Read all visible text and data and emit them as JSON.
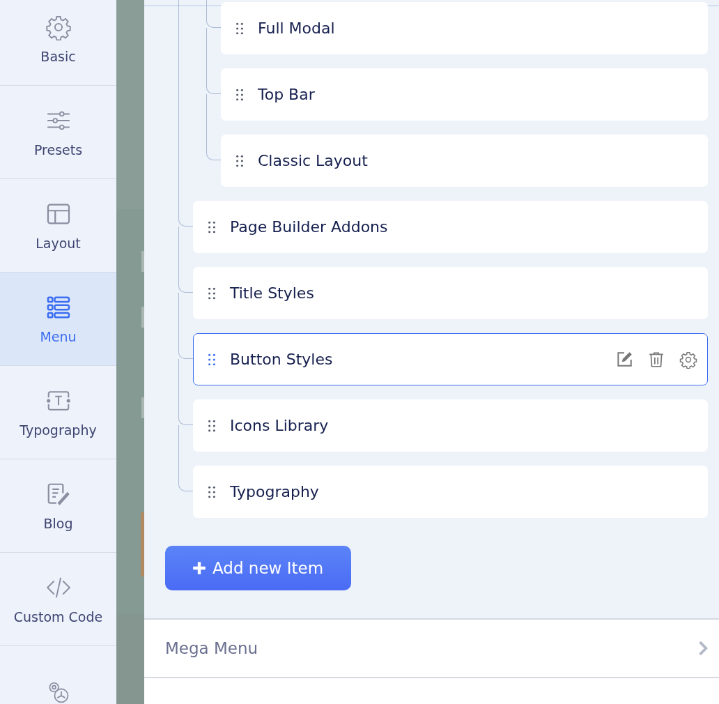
{
  "sidebar": {
    "items": [
      {
        "label": "Basic",
        "selected": false
      },
      {
        "label": "Presets",
        "selected": false
      },
      {
        "label": "Layout",
        "selected": false
      },
      {
        "label": "Menu",
        "selected": true
      },
      {
        "label": "Typography",
        "selected": false
      },
      {
        "label": "Blog",
        "selected": false
      },
      {
        "label": "Custom Code",
        "selected": false
      },
      {
        "selected": false
      }
    ]
  },
  "menu_tree": [
    {
      "children": [
        {
          "label": "Full Modal",
          "selected": false
        },
        {
          "label": "Top Bar",
          "selected": false
        },
        {
          "label": "Classic Layout",
          "selected": false
        }
      ]
    },
    {
      "label": "Page Builder Addons",
      "selected": false
    },
    {
      "label": "Title Styles",
      "selected": false
    },
    {
      "label": "Button Styles",
      "selected": true
    },
    {
      "label": "Icons Library",
      "selected": false
    },
    {
      "label": "Typography",
      "selected": false
    }
  ],
  "add_button": {
    "label": "Add new Item"
  },
  "sections": [
    {
      "label": "Mega Menu"
    }
  ]
}
